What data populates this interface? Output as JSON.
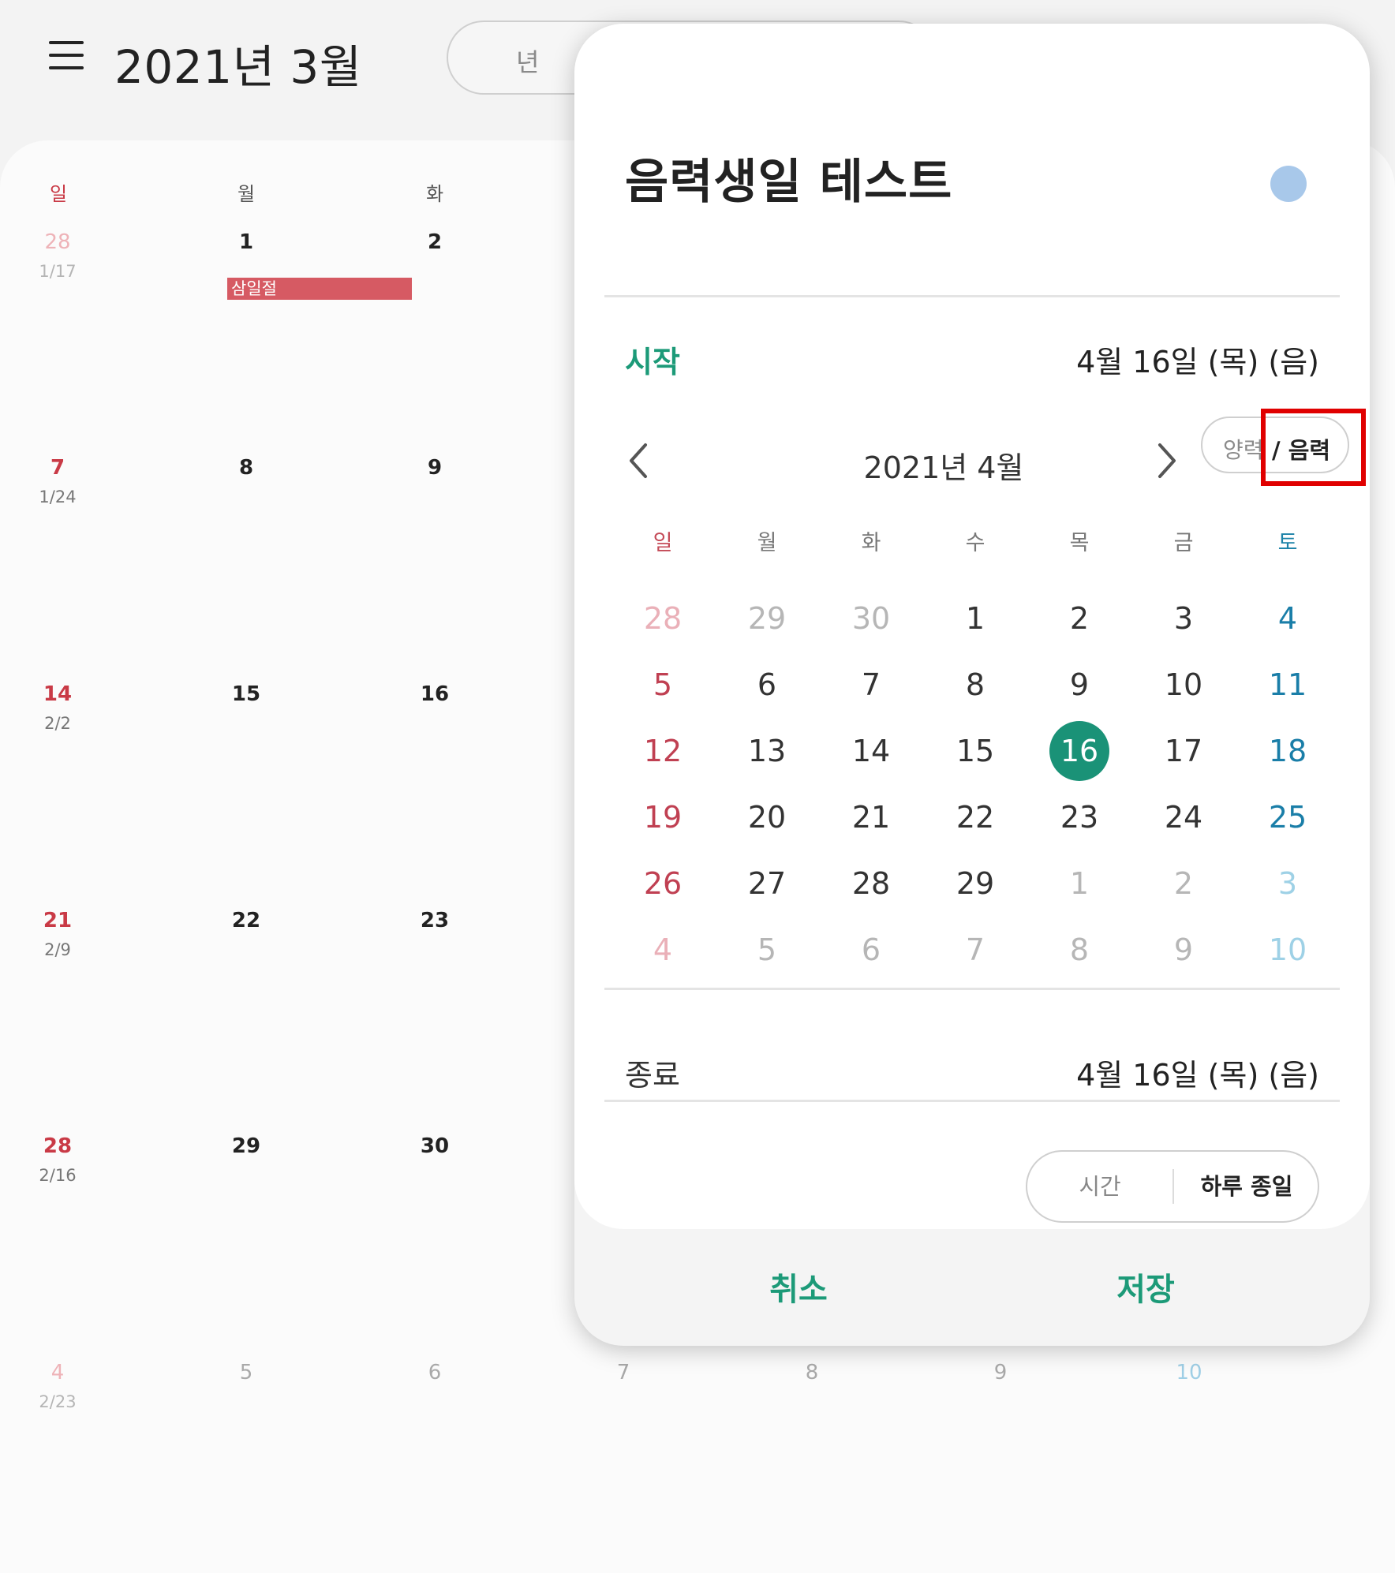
{
  "header": {
    "title": "2021년 3월",
    "view_option": "년"
  },
  "month": {
    "weekdays": [
      "일",
      "월",
      "화"
    ],
    "rows": [
      [
        {
          "d": "28",
          "l": "1/17"
        },
        {
          "d": "1",
          "l": ""
        },
        {
          "d": "2",
          "l": ""
        }
      ],
      [
        {
          "d": "7",
          "l": "1/24"
        },
        {
          "d": "8",
          "l": ""
        },
        {
          "d": "9",
          "l": ""
        }
      ],
      [
        {
          "d": "14",
          "l": "2/2"
        },
        {
          "d": "15",
          "l": ""
        },
        {
          "d": "16",
          "l": ""
        }
      ],
      [
        {
          "d": "21",
          "l": "2/9"
        },
        {
          "d": "22",
          "l": ""
        },
        {
          "d": "23",
          "l": ""
        }
      ],
      [
        {
          "d": "28",
          "l": "2/16"
        },
        {
          "d": "29",
          "l": ""
        },
        {
          "d": "30",
          "l": ""
        }
      ],
      [
        {
          "d": "4",
          "l": "2/23"
        },
        {
          "d": "5",
          "l": ""
        },
        {
          "d": "6",
          "l": ""
        },
        {
          "d": "7",
          "l": ""
        },
        {
          "d": "8",
          "l": ""
        },
        {
          "d": "9",
          "l": ""
        },
        {
          "d": "10",
          "l": ""
        }
      ]
    ],
    "holiday": "삼일절"
  },
  "dialog": {
    "event_title": "음력생일 테스트",
    "color": "#a8c8ea",
    "start_label": "시작",
    "start_value": "4월 16일 (목) (음)",
    "calendar_title": "2021년 4월",
    "solar_label": "양력",
    "lunar_label": "/ 음력",
    "weekdays": [
      "일",
      "월",
      "화",
      "수",
      "목",
      "금",
      "토"
    ],
    "weeks": [
      [
        "28",
        "29",
        "30",
        "1",
        "2",
        "3",
        "4"
      ],
      [
        "5",
        "6",
        "7",
        "8",
        "9",
        "10",
        "11"
      ],
      [
        "12",
        "13",
        "14",
        "15",
        "16",
        "17",
        "18"
      ],
      [
        "19",
        "20",
        "21",
        "22",
        "23",
        "24",
        "25"
      ],
      [
        "26",
        "27",
        "28",
        "29",
        "1",
        "2",
        "3"
      ],
      [
        "4",
        "5",
        "6",
        "7",
        "8",
        "9",
        "10"
      ]
    ],
    "selected_day": "16",
    "end_label": "종료",
    "end_value": "4월 16일 (목) (음)",
    "time_label": "시간",
    "allday_label": "하루 종일",
    "cancel_label": "취소",
    "save_label": "저장"
  },
  "colors": {
    "accent": "#1c9a78",
    "selected": "#1a9277",
    "sunday": "#c93a46",
    "saturday": "#1a7ea8",
    "holiday": "#d65a63",
    "highlight": "#e00000"
  }
}
